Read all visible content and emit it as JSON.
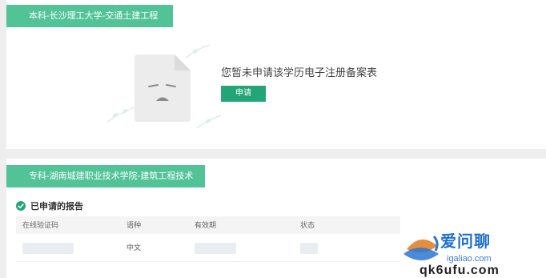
{
  "record1": {
    "banner": "本科-长沙理工大学-交通土建工程",
    "empty_message": "您暂未申请该学历电子注册备案表",
    "apply_button": "申请"
  },
  "record2": {
    "banner": "专科-湖南城建职业技术学院-建筑工程技术",
    "section_title": "已申请的报告",
    "columns": [
      "在线验证码",
      "语种",
      "有效期",
      "状态"
    ],
    "rows": [
      {
        "language": "中文"
      }
    ]
  },
  "watermark": {
    "brand": "爱问聊",
    "domain": "igaliao.com",
    "bottom": "qk6ufu.com"
  },
  "colors": {
    "banner_green": "#52c398",
    "button_green": "#23a578",
    "page_bg": "#eeeeee"
  }
}
